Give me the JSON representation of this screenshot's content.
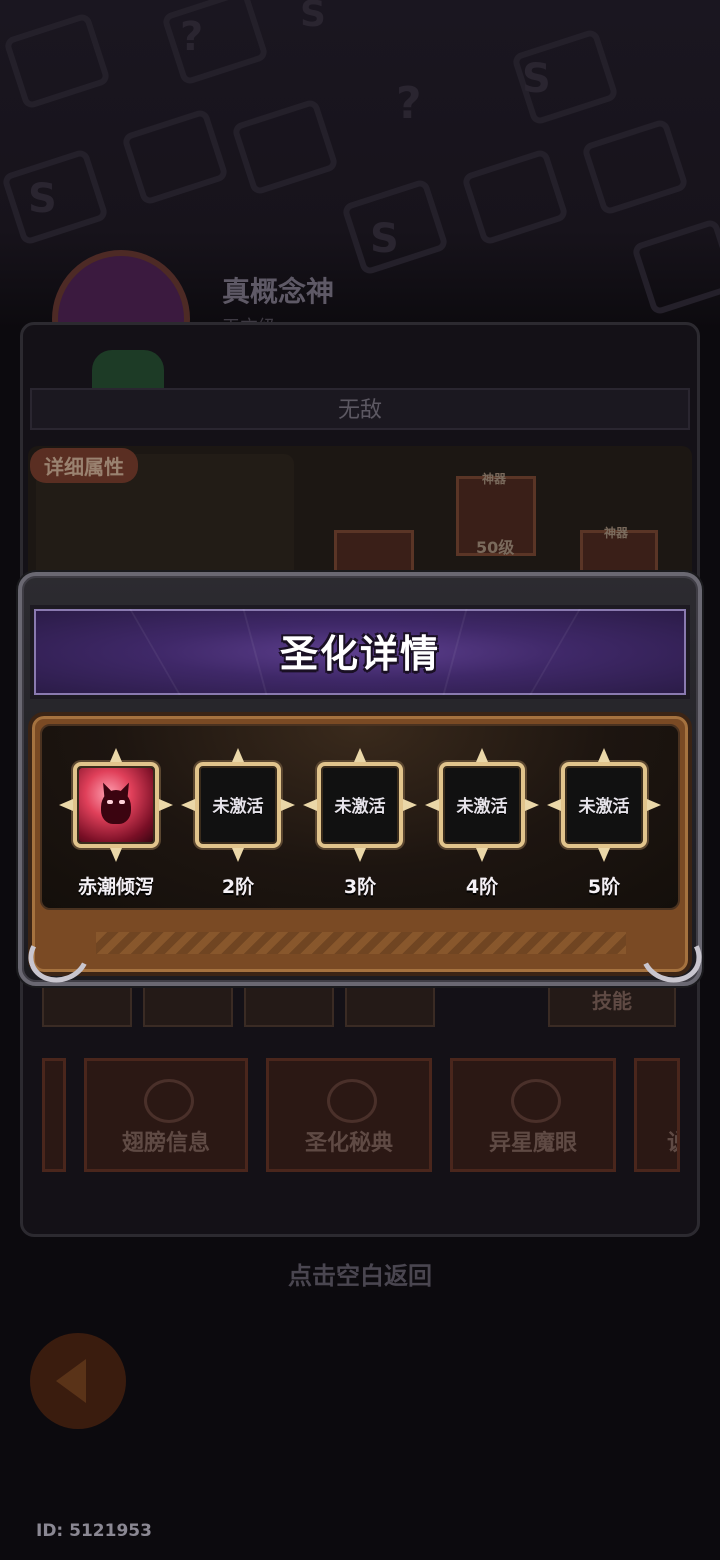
{
  "background": {
    "hero": {
      "name": "真概念神",
      "subtitle": "天方级"
    },
    "bar_text": "无敌",
    "detail_tag": "详细属性",
    "equip_slots": [
      {
        "tag": "神器",
        "level": "50级"
      },
      {
        "tag": "神器",
        "level": ""
      }
    ],
    "side_button": "技能",
    "nav_buttons": [
      "翅膀信息",
      "圣化秘典",
      "异星魔眼",
      "说"
    ],
    "hint": "点击空白返回",
    "user_id": "ID: 5121953"
  },
  "dialog": {
    "title": "圣化详情",
    "slots": [
      {
        "state": "active",
        "icon": "crimson-demon-icon",
        "label": "赤潮倾泻"
      },
      {
        "state": "inactive",
        "status_text": "未激活",
        "label": "2阶"
      },
      {
        "state": "inactive",
        "status_text": "未激活",
        "label": "3阶"
      },
      {
        "state": "inactive",
        "status_text": "未激活",
        "label": "4阶"
      },
      {
        "state": "inactive",
        "status_text": "未激活",
        "label": "5阶"
      }
    ]
  },
  "colors": {
    "header_purple": "#4a2f78",
    "body_brown": "#7a4a24",
    "slot_gold": "#e1c48c"
  }
}
